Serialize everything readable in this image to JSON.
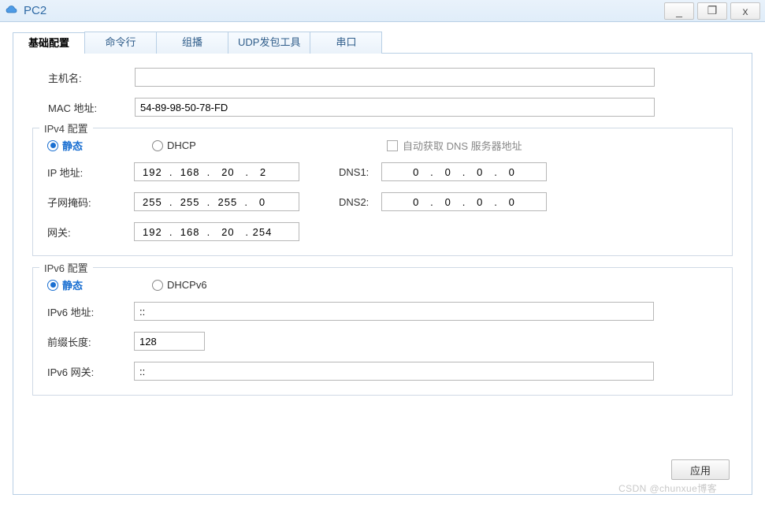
{
  "window": {
    "title": "PC2",
    "minimize": "_",
    "maximize": "❐",
    "close": "x"
  },
  "tabs": {
    "basic": "基础配置",
    "cmd": "命令行",
    "multicast": "组播",
    "udp": "UDP发包工具",
    "serial": "串口"
  },
  "labels": {
    "hostname": "主机名:",
    "mac": "MAC 地址:",
    "ipv4_section": "IPv4 配置",
    "static": "静态",
    "dhcp": "DHCP",
    "autodns": "自动获取 DNS 服务器地址",
    "ip": "IP 地址:",
    "mask": "子网掩码:",
    "gateway": "网关:",
    "dns1": "DNS1:",
    "dns2": "DNS2:",
    "ipv6_section": "IPv6 配置",
    "dhcpv6": "DHCPv6",
    "ipv6addr": "IPv6 地址:",
    "prefix": "前缀长度:",
    "ipv6gw": "IPv6 网关:",
    "apply": "应用"
  },
  "values": {
    "hostname": "",
    "mac": "54-89-98-50-78-FD",
    "ipv4_mode": "static",
    "ip": "192  .  168  .   20   .   2",
    "mask": "255  .  255  .  255  .   0",
    "gateway": "192  .  168  .   20   . 254",
    "dns1": "0   .   0   .   0   .   0",
    "dns2": "0   .   0   .   0   .   0",
    "autodns": false,
    "ipv6_mode": "static",
    "ipv6addr": "::",
    "prefix": "128",
    "ipv6gw": "::"
  },
  "watermark": "CSDN @chunxue博客"
}
